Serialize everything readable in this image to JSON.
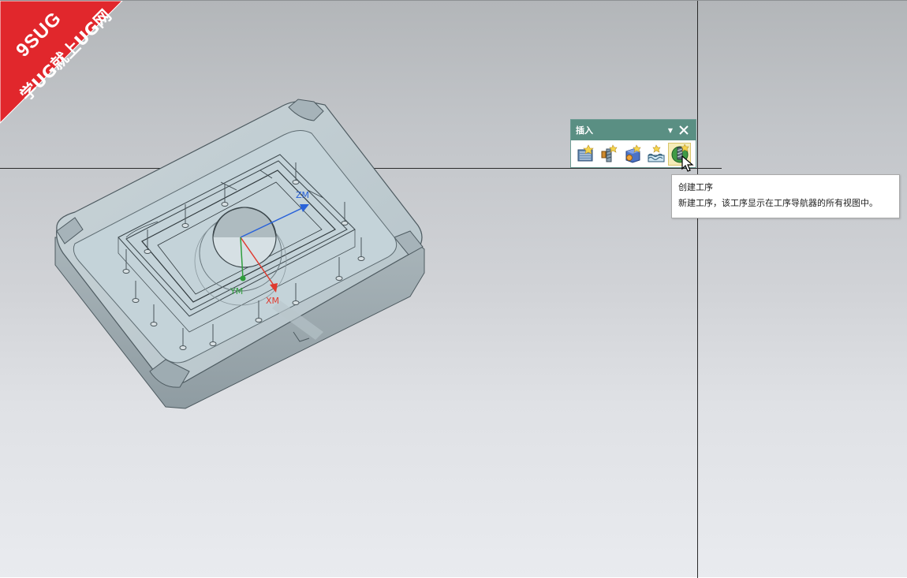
{
  "watermark": {
    "line1": "9SUG",
    "line2": "学UG就上UG网"
  },
  "toolbar": {
    "title": "插入",
    "dropdown_icon": "chevron-down-icon",
    "buttons": [
      {
        "name": "create-program-icon"
      },
      {
        "name": "create-tool-icon"
      },
      {
        "name": "create-geometry-icon"
      },
      {
        "name": "create-method-icon"
      },
      {
        "name": "create-operation-icon"
      }
    ]
  },
  "tooltip": {
    "title": "创建工序",
    "description": "新建工序，该工序显示在工序导航器的所有视图中。"
  },
  "csys": {
    "zm": "ZM",
    "ym": "YM",
    "xm": "XM"
  }
}
